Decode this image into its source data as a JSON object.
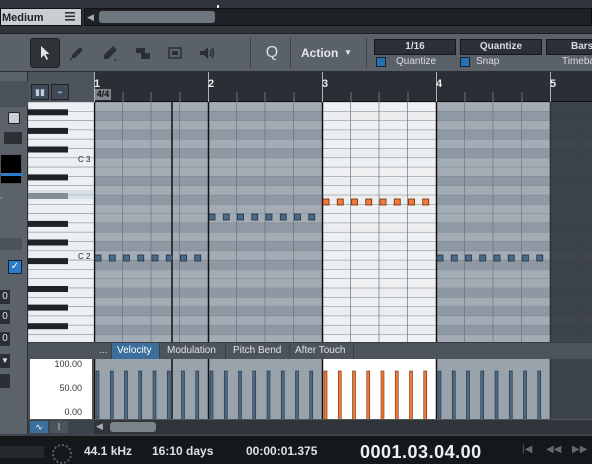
{
  "top": {
    "track_name": "Medium",
    "menu_icon": "hamburger-icon",
    "scroll_left_icon": "◀"
  },
  "toolbar": {
    "tools": [
      "arrow-tool-icon",
      "eraser-tool-icon",
      "pencil-tool-icon",
      "bend-tool-icon",
      "mute-tool-icon",
      "speaker-tool-icon"
    ],
    "q_label": "Q",
    "action_label": "Action",
    "quantize_value": "1/16",
    "quantize_label": "Quantize",
    "quantize_button": "Quantize",
    "snap_label": "Snap",
    "timebase_value": "Bars",
    "timebase_label": "Timeba"
  },
  "ruler": {
    "bars": [
      "1",
      "2",
      "3",
      "4",
      "5"
    ],
    "time_signature": "4/4"
  },
  "keyboard": {
    "labels": [
      "C 3",
      "C 2"
    ]
  },
  "inspector": {
    "values": [
      "0",
      "0",
      "0"
    ]
  },
  "lane": {
    "tabs": [
      "...",
      "Velocity",
      "Modulation",
      "Pitch Bend",
      "After Touch"
    ],
    "active_tab": "Velocity",
    "scale": [
      "100.00",
      "50.00",
      "0.00"
    ]
  },
  "notes": {
    "bar1_pitch": "C 2",
    "bar3_selected": true
  },
  "transport": {
    "sample_rate": "44.1 kHz",
    "days": "16:10 days",
    "time": "00:00:01.375",
    "position": "0001.03.04.00"
  },
  "colors": {
    "note": "#4c6a86",
    "note_selected": "#f07a3a",
    "accent_blue": "#2d7cc9"
  }
}
